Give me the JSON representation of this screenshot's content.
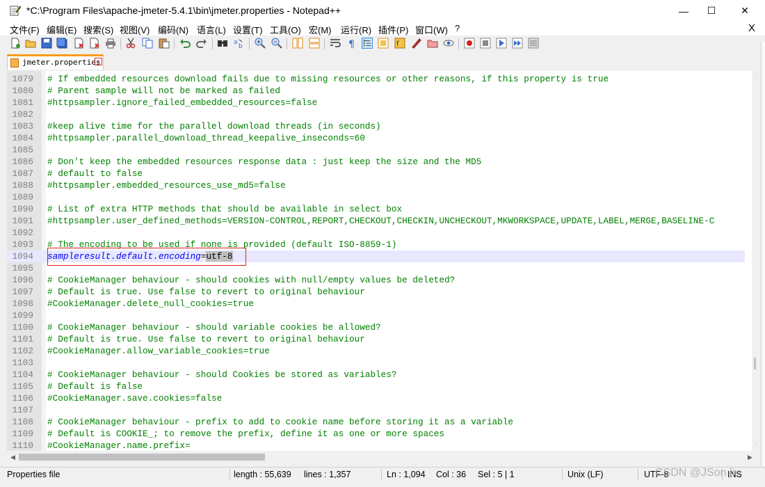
{
  "window": {
    "title": "*C:\\Program Files\\apache-jmeter-5.4.1\\bin\\jmeter.properties - Notepad++",
    "minimize_glyph": "—",
    "maximize_glyph": "☐",
    "close_glyph": "✕"
  },
  "menu": {
    "items": [
      {
        "label": "文件(F)"
      },
      {
        "label": "编辑(E)"
      },
      {
        "label": "搜索(S)"
      },
      {
        "label": "视图(V)"
      },
      {
        "label": "编码(N)"
      },
      {
        "label": "语言(L)"
      },
      {
        "label": "设置(T)"
      },
      {
        "label": "工具(O)"
      },
      {
        "label": "宏(M)"
      },
      {
        "label": "运行(R)"
      },
      {
        "label": "插件(P)"
      },
      {
        "label": "窗口(W)"
      },
      {
        "label": "?"
      }
    ],
    "close_label": "X"
  },
  "toolbar": {
    "icons": [
      "new-file-icon",
      "open-file-icon",
      "save-icon",
      "save-all-icon",
      "close-icon",
      "close-all-icon",
      "print-icon",
      "cut-icon",
      "copy-icon",
      "paste-icon",
      "undo-icon",
      "redo-icon",
      "find-icon",
      "replace-icon",
      "zoom-in-icon",
      "zoom-out-icon",
      "sync-vertical-icon",
      "sync-horizontal-icon",
      "word-wrap-icon",
      "show-all-chars-icon",
      "indent-guide-icon",
      "doc-map-icon",
      "function-list-icon",
      "folder-workspace-icon",
      "monitor-icon",
      "record-macro-icon",
      "stop-macro-icon",
      "play-macro-icon",
      "run-macro-multiple-icon",
      "save-macro-icon"
    ]
  },
  "tab": {
    "label": "jmeter.properties",
    "close_glyph": "x"
  },
  "editor": {
    "lines": [
      {
        "n": "1079",
        "text": "# If embedded resources download fails due to missing resources or other reasons, if this property is true"
      },
      {
        "n": "1080",
        "text": "# Parent sample will not be marked as failed"
      },
      {
        "n": "1081",
        "text": "#httpsampler.ignore_failed_embedded_resources=false"
      },
      {
        "n": "1082",
        "text": ""
      },
      {
        "n": "1083",
        "text": "#keep alive time for the parallel download threads (in seconds)"
      },
      {
        "n": "1084",
        "text": "#httpsampler.parallel_download_thread_keepalive_inseconds=60"
      },
      {
        "n": "1085",
        "text": ""
      },
      {
        "n": "1086",
        "text": "# Don't keep the embedded resources response data : just keep the size and the MD5"
      },
      {
        "n": "1087",
        "text": "# default to false"
      },
      {
        "n": "1088",
        "text": "#httpsampler.embedded_resources_use_md5=false"
      },
      {
        "n": "1089",
        "text": ""
      },
      {
        "n": "1090",
        "text": "# List of extra HTTP methods that should be available in select box"
      },
      {
        "n": "1091",
        "text": "#httpsampler.user_defined_methods=VERSION-CONTROL,REPORT,CHECKOUT,CHECKIN,UNCHECKOUT,MKWORKSPACE,UPDATE,LABEL,MERGE,BASELINE-C"
      },
      {
        "n": "1092",
        "text": ""
      },
      {
        "n": "1093",
        "text": "# The encoding to be used if none is provided (default ISO-8859-1)"
      },
      {
        "n": "1094",
        "text": "",
        "key": "sampleresult.default.encoding",
        "op": "=",
        "value": "utf-8",
        "current": true
      },
      {
        "n": "1095",
        "text": ""
      },
      {
        "n": "1096",
        "text": "# CookieManager behaviour - should cookies with null/empty values be deleted?"
      },
      {
        "n": "1097",
        "text": "# Default is true. Use false to revert to original behaviour"
      },
      {
        "n": "1098",
        "text": "#CookieManager.delete_null_cookies=true"
      },
      {
        "n": "1099",
        "text": ""
      },
      {
        "n": "1100",
        "text": "# CookieManager behaviour - should variable cookies be allowed?"
      },
      {
        "n": "1101",
        "text": "# Default is true. Use false to revert to original behaviour"
      },
      {
        "n": "1102",
        "text": "#CookieManager.allow_variable_cookies=true"
      },
      {
        "n": "1103",
        "text": ""
      },
      {
        "n": "1104",
        "text": "# CookieManager behaviour - should Cookies be stored as variables?"
      },
      {
        "n": "1105",
        "text": "# Default is false"
      },
      {
        "n": "1106",
        "text": "#CookieManager.save.cookies=false"
      },
      {
        "n": "1107",
        "text": ""
      },
      {
        "n": "1108",
        "text": "# CookieManager behaviour - prefix to add to cookie name before storing it as a variable"
      },
      {
        "n": "1109",
        "text": "# Default is COOKIE_; to remove the prefix, define it as one or more spaces"
      },
      {
        "n": "1110",
        "text": "#CookieManager.name.prefix="
      }
    ]
  },
  "status": {
    "file_type": "Properties file",
    "length": "length : 55,639",
    "lines": "lines : 1,357",
    "ln": "Ln : 1,094",
    "col": "Col : 36",
    "sel": "Sel : 5 | 1",
    "eol": "Unix (LF)",
    "encoding": "UTF-8",
    "mode": "INS"
  },
  "watermark": "CSDN @JSon liu",
  "colors": {
    "comment": "#008000",
    "key": "#0000ff",
    "tab_accent": "#fa9a1a",
    "current_line": "#e8e8ff",
    "highlight_box": "#e02020"
  }
}
